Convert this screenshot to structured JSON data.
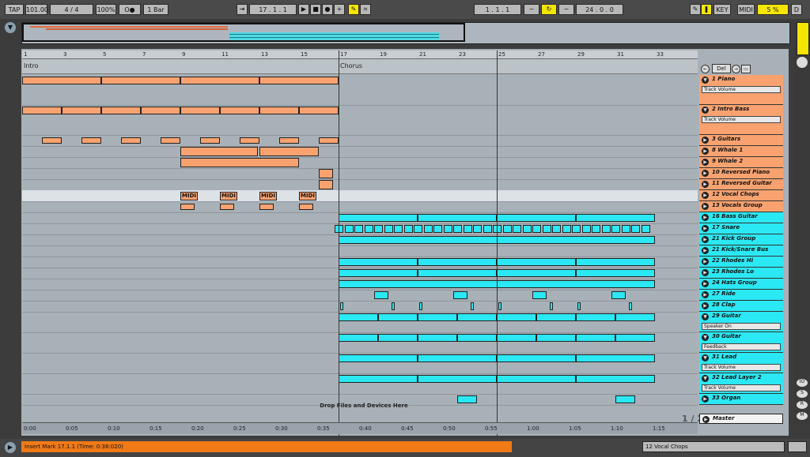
{
  "transport": {
    "tap": "TAP",
    "tempo": "101.00",
    "signature": "4 / 4",
    "zoom": "100%",
    "metro": "O●",
    "quant": "1 Bar",
    "position": "17 .  1 .  1",
    "loop_start": "1 .  1 .  1",
    "loop_len": "24 .  0 .  0",
    "key": "KEY",
    "midi": "MIDI",
    "cpu": "5 %",
    "d": "D"
  },
  "ruler_bars": [
    "1",
    "3",
    "5",
    "7",
    "9",
    "11",
    "13",
    "15",
    "17",
    "19",
    "21",
    "23",
    "25",
    "27",
    "29",
    "31",
    "33"
  ],
  "locators": {
    "intro": "Intro",
    "chorus": "Chorus"
  },
  "side_top": {
    "del": "Del"
  },
  "page_indicator": "1 / 2",
  "drop_text": "Drop Files and Devices Here",
  "midi_label": "MIDI",
  "timeline": [
    "0:00",
    "0:05",
    "0:10",
    "0:15",
    "0:20",
    "0:25",
    "0:30",
    "0:35",
    "0:40",
    "0:45",
    "0:50",
    "0:55",
    "1:00",
    "1:05",
    "1:10",
    "1:15"
  ],
  "tracks": [
    {
      "name": "1 Piano",
      "color": "#f9a270",
      "sel": "Track Volume"
    },
    {
      "name": "2 Intro Bass",
      "color": "#f9a270",
      "sel": "Track Volume"
    },
    {
      "name": "3 Guitars",
      "color": "#f9a270"
    },
    {
      "name": "8 Whale 1",
      "color": "#f9a270"
    },
    {
      "name": "9 Whale 2",
      "color": "#f9a270"
    },
    {
      "name": "10 Reversed Piano",
      "color": "#f9a270"
    },
    {
      "name": "11 Reversed Guitar",
      "color": "#f9a270"
    },
    {
      "name": "12 Vocal Chops",
      "color": "#f9a270"
    },
    {
      "name": "13 Vocals Group",
      "color": "#f9a270"
    },
    {
      "name": "16 Bass Guitar",
      "color": "#2ae8f4"
    },
    {
      "name": "17 Snare",
      "color": "#2ae8f4"
    },
    {
      "name": "21 Kick Group",
      "color": "#2ae8f4"
    },
    {
      "name": "21 Kick/Snare Bus",
      "color": "#2ae8f4"
    },
    {
      "name": "22 Rhodes Hi",
      "color": "#2ae8f4"
    },
    {
      "name": "23 Rhodes Lo",
      "color": "#2ae8f4"
    },
    {
      "name": "24 Hats Group",
      "color": "#2ae8f4"
    },
    {
      "name": "27 Ride",
      "color": "#2ae8f4"
    },
    {
      "name": "28 Clap",
      "color": "#2ae8f4"
    },
    {
      "name": "29 Guitar",
      "color": "#2ae8f4",
      "sel": "Speaker On"
    },
    {
      "name": "30 Guitar",
      "color": "#2ae8f4",
      "sel": "Feedback"
    },
    {
      "name": "31 Lead",
      "color": "#2ae8f4",
      "sel": "Track Volume"
    },
    {
      "name": "32 Lead Layer 2",
      "color": "#2ae8f4",
      "sel": "Track Volume"
    },
    {
      "name": "33 Organ",
      "color": "#2ae8f4"
    }
  ],
  "master": "Master",
  "status": {
    "message": "Insert Mark 17.1.1 (Time: 0:38:020)",
    "track": "12 Vocal Chops"
  }
}
